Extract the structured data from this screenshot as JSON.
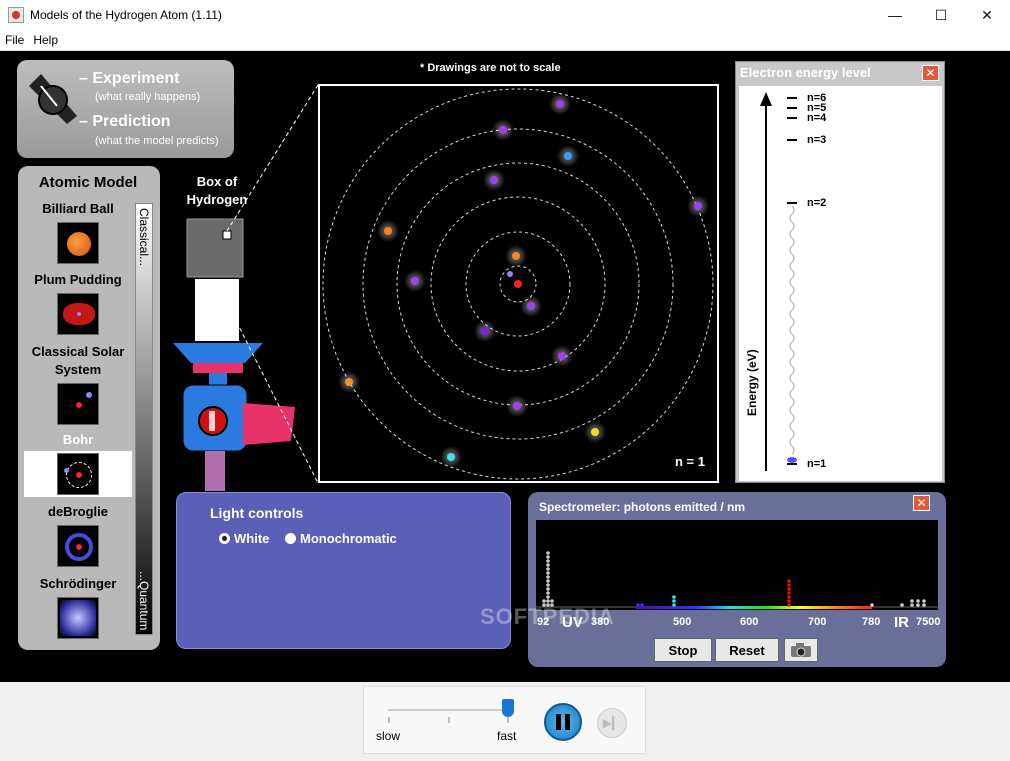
{
  "window": {
    "title": "Models of the Hydrogen Atom (1.11)",
    "minimize": "—",
    "maximize": "☐",
    "close": "✕"
  },
  "menu": [
    "File",
    "Help"
  ],
  "mode": {
    "experiment": "– Experiment",
    "experiment_sub": "(what really happens)",
    "prediction": "– Prediction",
    "prediction_sub": "(what the model predicts)"
  },
  "atomic_model": {
    "title": "Atomic Model",
    "items": [
      "Billiard Ball",
      "Plum Pudding",
      "Classical Solar System",
      "Bohr",
      "deBroglie",
      "Schrödinger"
    ],
    "selected": "Bohr",
    "scale_top": "Classical...",
    "scale_bottom": "...Quantum"
  },
  "box": {
    "label": "Box of Hydrogen"
  },
  "view": {
    "note": "* Drawings are not to scale",
    "state": "n = 1"
  },
  "energy": {
    "title": "Electron energy level",
    "axis": "Energy (eV)",
    "levels": [
      "n=6",
      "n=5",
      "n=4",
      "n=3",
      "n=2",
      "n=1"
    ]
  },
  "light": {
    "title": "Light controls",
    "white": "White",
    "mono": "Monochromatic",
    "selected": "White"
  },
  "spectrometer": {
    "title": "Spectrometer: photons emitted / nm",
    "ticks": [
      "92",
      "UV",
      "380",
      "500",
      "600",
      "700",
      "780",
      "IR",
      "7500"
    ],
    "stop": "Stop",
    "reset": "Reset"
  },
  "watermark": "SOFTPEDIA",
  "playback": {
    "slow": "slow",
    "fast": "fast"
  }
}
